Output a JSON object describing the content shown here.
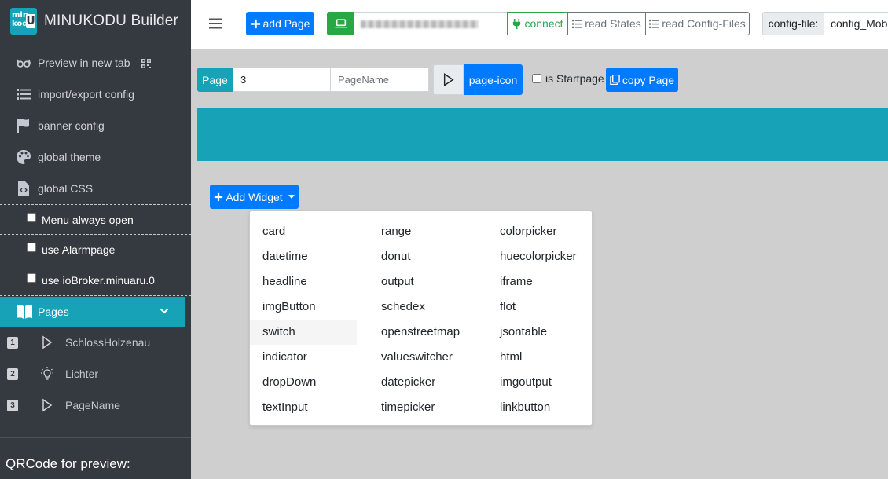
{
  "app": {
    "title": "MINUKODU Builder",
    "logo_text_1": "min",
    "logo_text_2": "kod",
    "logo_text_u": "U"
  },
  "sidebar": {
    "items": [
      {
        "label": "Preview in new tab",
        "icon": "glasses-icon"
      },
      {
        "label": "import/export config",
        "icon": "list-icon"
      },
      {
        "label": "banner config",
        "icon": "flag-icon"
      },
      {
        "label": "global theme",
        "icon": "palette-icon"
      },
      {
        "label": "global CSS",
        "icon": "file-code-icon"
      }
    ],
    "checkboxes": [
      {
        "label": "Menu always open",
        "checked": false
      },
      {
        "label": "use Alarmpage",
        "checked": false
      },
      {
        "label": "use ioBroker.minuaru.0",
        "checked": false
      }
    ],
    "pages_label": "Pages",
    "pages": [
      {
        "num": "1",
        "name": "SchlossHolzenau",
        "icon": "play-outline-icon"
      },
      {
        "num": "2",
        "name": "Lichter",
        "icon": "lightbulb-icon"
      },
      {
        "num": "3",
        "name": "PageName",
        "icon": "play-outline-icon"
      }
    ],
    "qr_title": "QRCode for preview:"
  },
  "toolbar": {
    "add_page": "add Page",
    "connect": "connect",
    "read_states": "read States",
    "read_config": "read Config-Files",
    "config_label": "config-file:",
    "config_value": "config_Mobi"
  },
  "page_editor": {
    "page_label": "Page",
    "page_number": "3",
    "page_name_placeholder": "PageName",
    "page_icon_label": "page-icon",
    "is_startpage_label": "is Startpage",
    "copy_page_label": "copy Page",
    "add_widget_label": "Add Widget"
  },
  "widgets": {
    "col1": [
      "card",
      "datetime",
      "headline",
      "imgButton",
      "switch",
      "indicator",
      "dropDown",
      "textInput"
    ],
    "col2": [
      "range",
      "donut",
      "output",
      "schedex",
      "openstreetmap",
      "valueswitcher",
      "datepicker",
      "timepicker"
    ],
    "col3": [
      "colorpicker",
      "huecolorpicker",
      "iframe",
      "flot",
      "jsontable",
      "html",
      "imgoutput",
      "linkbutton"
    ],
    "hovered": "switch"
  },
  "colors": {
    "sidebar_bg": "#343a40",
    "accent_teal": "#17a2b8",
    "primary": "#007bff",
    "success": "#28a745"
  }
}
